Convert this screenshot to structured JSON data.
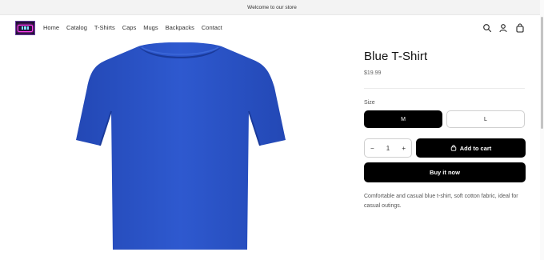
{
  "announcement": {
    "text": "Welcome to our store"
  },
  "header": {
    "nav": [
      "Home",
      "Catalog",
      "T-Shirts",
      "Caps",
      "Mugs",
      "Backpacks",
      "Contact"
    ],
    "icons": [
      "search-icon",
      "account-icon",
      "cart-icon"
    ]
  },
  "product": {
    "title": "Blue T-Shirt",
    "price": "$19.99",
    "size_label": "Size",
    "sizes": [
      "M",
      "L"
    ],
    "selected_size": "M",
    "quantity": "1",
    "quantity_minus": "−",
    "quantity_plus": "+",
    "add_to_cart": "Add to cart",
    "buy_now": "Buy it now",
    "description": "Comfortable and casual blue t-shirt, soft cotton fabric, ideal for casual outings.",
    "image_color": "#2a54c8"
  },
  "colors": {
    "primary_button": "#000000",
    "shirt": "#2a54c8"
  }
}
